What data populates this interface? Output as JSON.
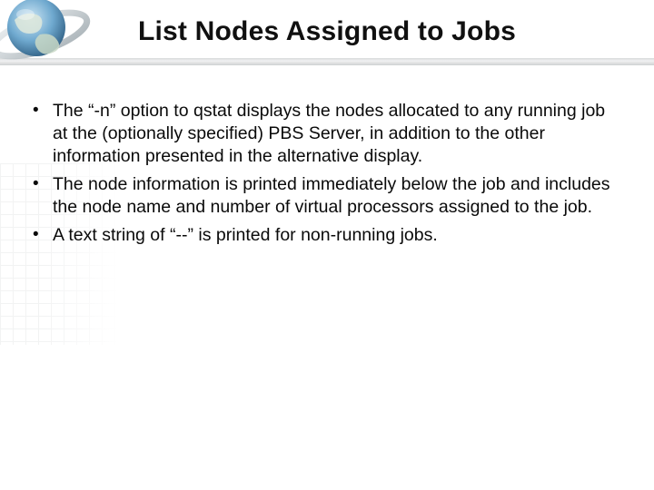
{
  "slide": {
    "title": "List Nodes Assigned to Jobs",
    "bullets": [
      "The “-n” option to qstat displays the nodes allocated to any running job at the (optionally specified) PBS Server, in addition to the other information presented in the alternative display.",
      "The node information is printed immediately below the job and includes the node name and number of virtual processors assigned to the job.",
      "A text string of “--” is printed for non-running jobs."
    ]
  }
}
